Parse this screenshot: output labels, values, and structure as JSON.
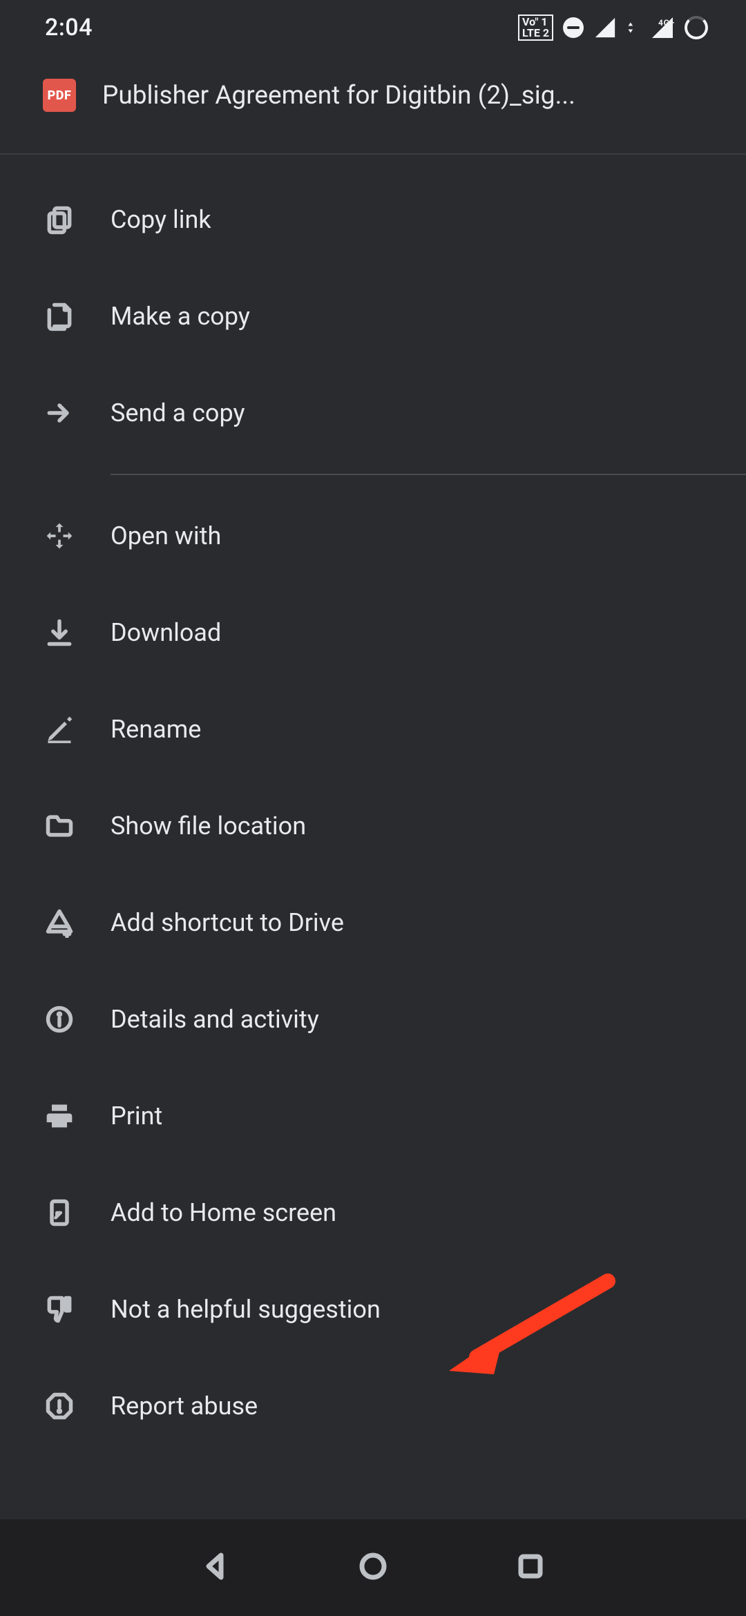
{
  "status": {
    "time": "2:04",
    "volte": "Vo) 1 LTE 2",
    "network_label": "4G+"
  },
  "header": {
    "badge": "PDF",
    "title": "Publisher Agreement for Digitbin  (2)_sig..."
  },
  "menu": {
    "group1": [
      {
        "label": "Copy link"
      },
      {
        "label": "Make a copy"
      },
      {
        "label": "Send a copy"
      }
    ],
    "group2": [
      {
        "label": "Open with"
      },
      {
        "label": "Download"
      },
      {
        "label": "Rename"
      },
      {
        "label": "Show file location"
      },
      {
        "label": "Add shortcut to Drive"
      },
      {
        "label": "Details and activity"
      },
      {
        "label": "Print"
      },
      {
        "label": "Add to Home screen"
      },
      {
        "label": "Not a helpful suggestion"
      },
      {
        "label": "Report abuse"
      }
    ]
  },
  "annotation": {
    "arrow_color": "#ff3b1f",
    "points_to": "Not a helpful suggestion"
  }
}
